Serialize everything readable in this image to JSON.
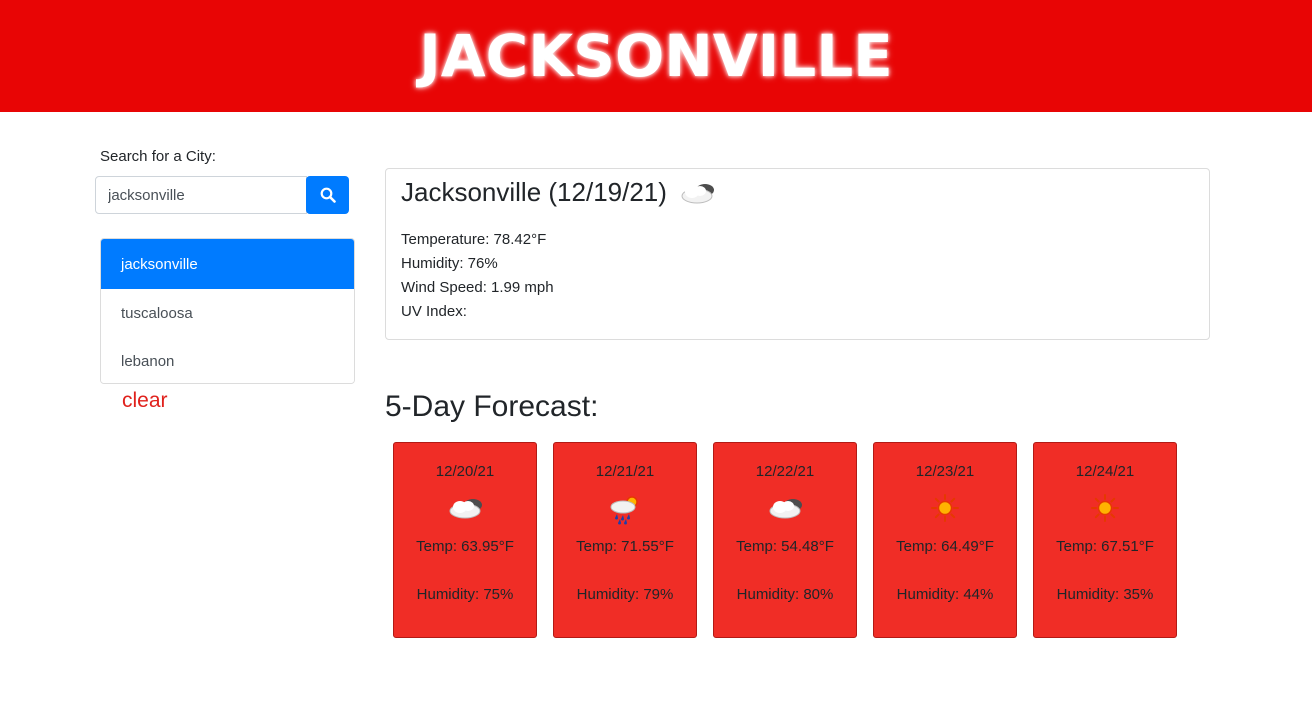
{
  "header": {
    "title": "JACKSONVILLE"
  },
  "search": {
    "label": "Search for a City:",
    "input_value": "jacksonville",
    "button_icon": "search-icon"
  },
  "history": {
    "items": [
      {
        "label": "jacksonville",
        "active": true
      },
      {
        "label": "tuscaloosa",
        "active": false
      },
      {
        "label": "lebanon",
        "active": false
      }
    ],
    "clear_label": "clear"
  },
  "current": {
    "title": "Jacksonville (12/19/21)",
    "icon": "cloud-icon",
    "temperature": "Temperature: 78.42°F",
    "humidity": "Humidity: 76%",
    "wind": "Wind Speed: 1.99 mph",
    "uv": "UV Index:"
  },
  "forecast": {
    "heading": "5-Day Forecast:",
    "days": [
      {
        "date": "12/20/21",
        "icon": "cloud-icon",
        "temp": "Temp: 63.95°F",
        "humidity": "Humidity: 75%"
      },
      {
        "date": "12/21/21",
        "icon": "rain-sun-icon",
        "temp": "Temp: 71.55°F",
        "humidity": "Humidity: 79%"
      },
      {
        "date": "12/22/21",
        "icon": "cloud-icon",
        "temp": "Temp: 54.48°F",
        "humidity": "Humidity: 80%"
      },
      {
        "date": "12/23/21",
        "icon": "sun-icon",
        "temp": "Temp: 64.49°F",
        "humidity": "Humidity: 44%"
      },
      {
        "date": "12/24/21",
        "icon": "sun-icon",
        "temp": "Temp: 67.51°F",
        "humidity": "Humidity: 35%"
      }
    ]
  },
  "colors": {
    "banner": "#e80505",
    "accent": "#007bff",
    "card": "#f02d26",
    "clear": "#e0211c"
  }
}
